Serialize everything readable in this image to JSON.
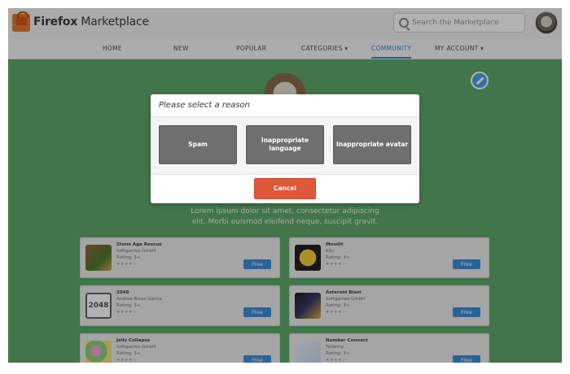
{
  "header": {
    "brand_bold": "Firefox",
    "brand_rest": " Marketplace",
    "search_placeholder": "Search the Marketplace"
  },
  "nav": {
    "items": [
      {
        "label": "HOME"
      },
      {
        "label": "NEW"
      },
      {
        "label": "POPULAR"
      },
      {
        "label": "CATEGORIES ▾"
      },
      {
        "label": "COMMUNITY"
      },
      {
        "label": "MY ACCOUNT ▾"
      }
    ],
    "active": "COMMUNITY"
  },
  "profile": {
    "bio_line1": "Lorem ipsum dolor sit amet, consectetur adipiscing",
    "bio_line2": "elit. Morbi euismod eleifend neque, suscipit gravit."
  },
  "apps": [
    {
      "name": "Stone Age Rescue",
      "developer": "Softgames GmbH",
      "rating": "Rating: 3+",
      "stars": "★★★★☆",
      "button": "Free",
      "icon": "stone-age-rescue-icon"
    },
    {
      "name": "Moodit",
      "developer": "Kiki",
      "rating": "Rating: 3+",
      "stars": "★★★★☆",
      "button": "Free",
      "icon": "moodit-icon"
    },
    {
      "name": "2048",
      "developer": "Andrea Bross Garcia",
      "rating": "Rating: 3+",
      "stars": "★★★★☆",
      "button": "Free",
      "icon": "2048-icon",
      "icon_text": "2048"
    },
    {
      "name": "Asteroid Blast",
      "developer": "Softgames GmbH",
      "rating": "Rating: 3+",
      "stars": "★★★★☆",
      "button": "Free",
      "icon": "asteroid-blast-icon"
    },
    {
      "name": "Jelly Collapse",
      "developer": "Softgames GmbH",
      "rating": "Rating: 3+",
      "stars": "★★★★☆",
      "button": "Free",
      "icon": "jelly-collapse-icon"
    },
    {
      "name": "Number Connect",
      "developer": "Tellwing",
      "rating": "Rating: 3+",
      "stars": "★★★★☆",
      "button": "Free",
      "icon": "number-connect-icon"
    }
  ],
  "modal": {
    "title": "Please select a reason",
    "reasons": [
      "Spam",
      "Inappropriate language",
      "Inappropriate avatar"
    ],
    "cancel_label": "Cancel"
  },
  "colors": {
    "page_bg": "#5fa86a",
    "accent": "#2a8fd8",
    "free_button": "#3d8fdc",
    "reason_button": "#6f6f6f",
    "cancel_button": "#e0583a"
  }
}
